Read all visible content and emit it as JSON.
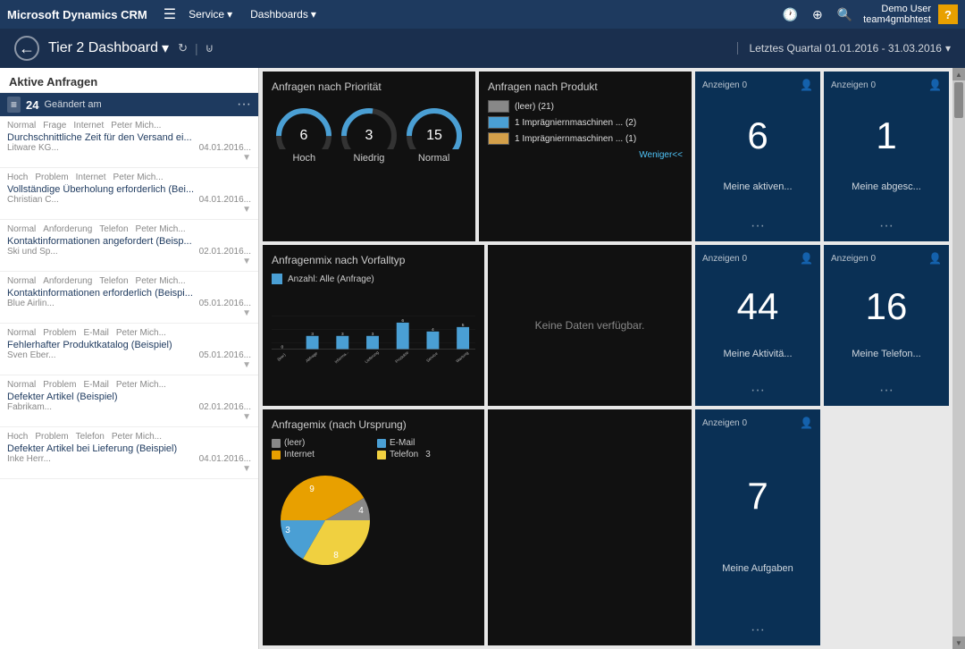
{
  "app": {
    "brand": "Microsoft Dynamics CRM",
    "nav_items": [
      "Service",
      "Dashboards"
    ],
    "user_name": "Demo User",
    "user_org": "team4gmbhtest"
  },
  "sub_header": {
    "dashboard_title": "Tier 2 Dashboard",
    "date_range": "Letztes Quartal 01.01.2016 - 31.03.2016"
  },
  "left_panel": {
    "title": "Aktive Anfragen",
    "count": "24",
    "subtitle": "Geändert am",
    "items": [
      {
        "priority": "Normal",
        "type": "Frage",
        "channel": "Internet",
        "agent": "Peter Mich...",
        "title": "Durchschnittliche Zeit für den Versand ei...",
        "company": "Litware KG...",
        "date": "04.01.2016..."
      },
      {
        "priority": "Hoch",
        "type": "Problem",
        "channel": "Internet",
        "agent": "Peter Mich...",
        "title": "Vollständige Überholung erforderlich (Bei...",
        "company": "Christian C...",
        "date": "04.01.2016..."
      },
      {
        "priority": "Normal",
        "type": "Anforderung",
        "channel": "Telefon",
        "agent": "Peter Mich...",
        "title": "Kontaktinformationen angefordert (Beisp...",
        "company": "Ski und Sp...",
        "date": "02.01.2016..."
      },
      {
        "priority": "Normal",
        "type": "Anforderung",
        "channel": "Telefon",
        "agent": "Peter Mich...",
        "title": "Kontaktinformationen erforderlich (Beispi...",
        "company": "Blue Airlin...",
        "date": "05.01.2016..."
      },
      {
        "priority": "Normal",
        "type": "Problem",
        "channel": "E-Mail",
        "agent": "Peter Mich...",
        "title": "Fehlerhafter Produktkatalog (Beispiel)",
        "company": "Sven Eber...",
        "date": "05.01.2016..."
      },
      {
        "priority": "Normal",
        "type": "Problem",
        "channel": "E-Mail",
        "agent": "Peter Mich...",
        "title": "Defekter Artikel (Beispiel)",
        "company": "Fabrikam...",
        "date": "02.01.2016..."
      },
      {
        "priority": "Hoch",
        "type": "Problem",
        "channel": "Telefon",
        "agent": "Peter Mich...",
        "title": "Defekter Artikel bei Lieferung (Beispiel)",
        "company": "Inke Herr...",
        "date": "04.01.2016..."
      }
    ]
  },
  "priority_chart": {
    "title": "Anfragen nach Priorität",
    "items": [
      {
        "label": "Hoch",
        "value": 6,
        "angle": 200
      },
      {
        "label": "Niedrig",
        "value": 3,
        "angle": 110
      },
      {
        "label": "Normal",
        "value": 15,
        "angle": 340
      }
    ]
  },
  "product_chart": {
    "title": "Anfragen nach Produkt",
    "items": [
      {
        "label": "(leer) (21)",
        "color": "#888"
      },
      {
        "label": "1 Imprägniernmaschinen ... (2)",
        "color": "#4a9fd4"
      },
      {
        "label": "1 Imprägniernmaschinen ... (1)",
        "color": "#d4a04a"
      }
    ],
    "link": "Weniger<<"
  },
  "bar_chart": {
    "title": "Anfragenmix nach Vorfalltyp",
    "legend": "Anzahl: Alle (Anfrage)",
    "bars": [
      {
        "label": "(leer)",
        "value": 0
      },
      {
        "label": "Abfrage",
        "value": 3
      },
      {
        "label": "Informa...",
        "value": 3
      },
      {
        "label": "Lieferung",
        "value": 3
      },
      {
        "label": "Produkte",
        "value": 6
      },
      {
        "label": "Service",
        "value": 4
      },
      {
        "label": "Wartung",
        "value": 5
      }
    ]
  },
  "no_data": {
    "text": "Keine Daten verfügbar."
  },
  "pie_chart": {
    "title": "Anfragemix (nach Ursprung)",
    "legend": [
      {
        "label": "(leer)",
        "color": "#888888"
      },
      {
        "label": "E-Mail",
        "color": "#4a9fd4"
      },
      {
        "label": "Internet",
        "color": "#e8a000"
      },
      {
        "label": "Telefon",
        "color": "#f0d040"
      }
    ],
    "segments": [
      {
        "label": "9",
        "color": "#e8a000"
      },
      {
        "label": "4",
        "color": "#888888"
      },
      {
        "label": "8",
        "color": "#f0d040"
      },
      {
        "label": "3",
        "color": "#4a9fd4"
      }
    ]
  },
  "kpi_tiles": [
    {
      "id": "tile1",
      "label": "Meine aktiven...",
      "value": "6",
      "show": "Anzeigen 0"
    },
    {
      "id": "tile2",
      "label": "Meine abgesc...",
      "value": "1",
      "show": "Anzeigen 0"
    },
    {
      "id": "tile3",
      "label": "Meine Aktivitä...",
      "value": "44",
      "show": "Anzeigen 0"
    },
    {
      "id": "tile4",
      "label": "Meine Telefon...",
      "value": "16",
      "show": "Anzeigen 0"
    },
    {
      "id": "tile5",
      "label": "Meine Aufgaben",
      "value": "7",
      "show": "Anzeigen 0"
    }
  ]
}
